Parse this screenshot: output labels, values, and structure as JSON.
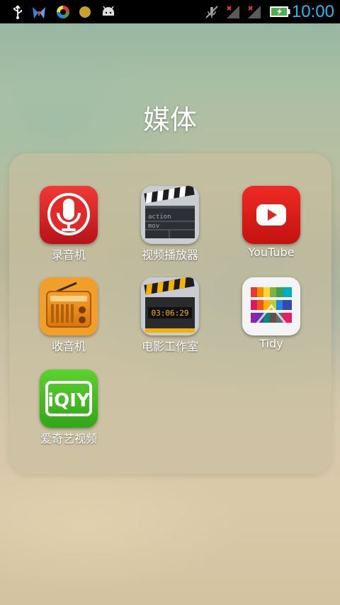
{
  "status_bar": {
    "time": "10:00",
    "left_icons": [
      "usb-icon",
      "bird-icon",
      "swirl-icon",
      "coin-icon",
      "android-icon"
    ],
    "right_icons": [
      "mute-icon",
      "signal-icon",
      "signal-icon",
      "battery-charging-icon"
    ],
    "clock_color": "#34b5e5"
  },
  "folder": {
    "title": "媒体",
    "apps": [
      {
        "label": "录音机",
        "icon": "microphone-icon"
      },
      {
        "label": "视频播放器",
        "icon": "clapperboard-icon"
      },
      {
        "label": "YouTube",
        "icon": "youtube-icon"
      },
      {
        "label": "收音机",
        "icon": "radio-icon"
      },
      {
        "label": "电影工作室",
        "icon": "movie-studio-icon"
      },
      {
        "label": "Tidy",
        "icon": "tidy-icon"
      },
      {
        "label": "爱奇艺视频",
        "icon": "iqiyi-icon"
      }
    ]
  },
  "clapperboard": {
    "line1": "action",
    "line2": "mov"
  },
  "movie_studio": {
    "counter": "03:06:29"
  },
  "iqiyi": {
    "text": "iQIY"
  }
}
